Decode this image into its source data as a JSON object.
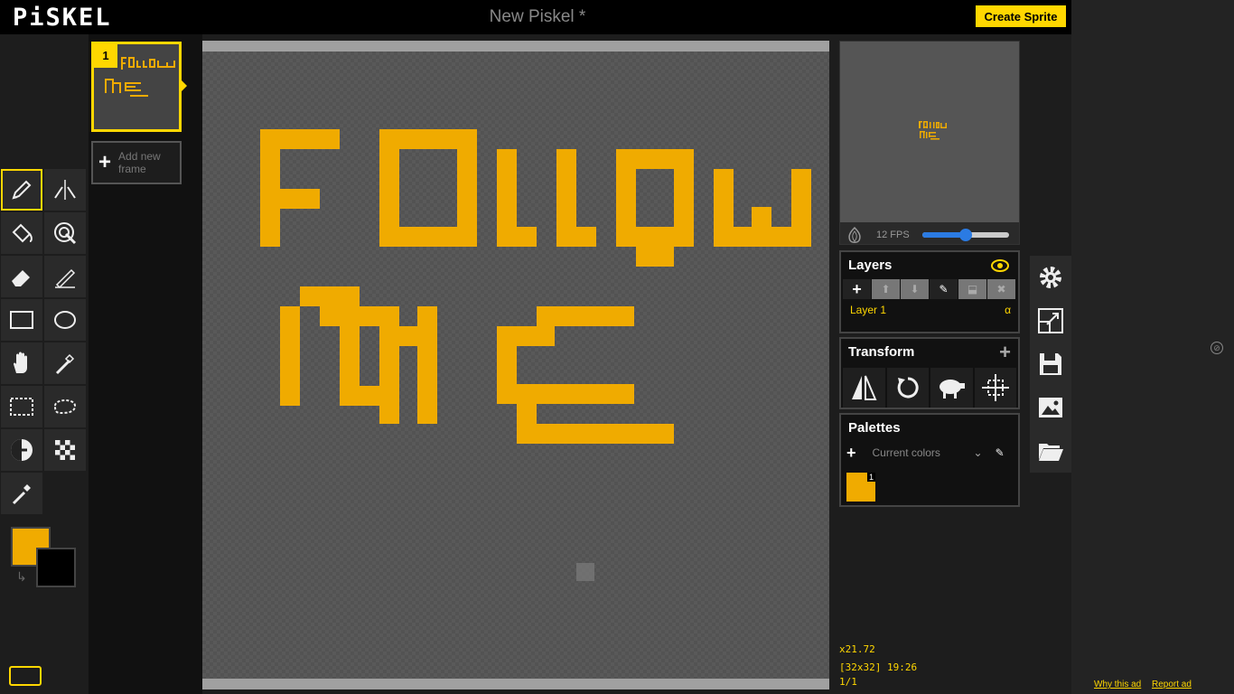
{
  "app": {
    "logo": "PiSKEL",
    "document_title": "New Piskel *",
    "create_button": "Create Sprite"
  },
  "frames": {
    "items": [
      {
        "number": "1"
      }
    ],
    "add_label": "Add new frame"
  },
  "preview": {
    "fps_label": "12 FPS",
    "fps": 12,
    "fps_fraction": 0.5
  },
  "layers": {
    "title": "Layers",
    "items": [
      {
        "name": "Layer 1",
        "alpha_label": "α"
      }
    ]
  },
  "transform": {
    "title": "Transform"
  },
  "palettes": {
    "title": "Palettes",
    "selected": "Current colors",
    "swatches": [
      {
        "color": "#f0ab00",
        "index": "1"
      }
    ]
  },
  "colors": {
    "primary": "#f0ab00",
    "secondary": "#000000",
    "accent": "#ffd700"
  },
  "status": {
    "zoom": "x21.72",
    "size_and_cursor": "[32x32] 19:26",
    "frame_counter": "1/1"
  },
  "ad": {
    "why_link": "Why this ad",
    "report_link": "Report ad"
  }
}
